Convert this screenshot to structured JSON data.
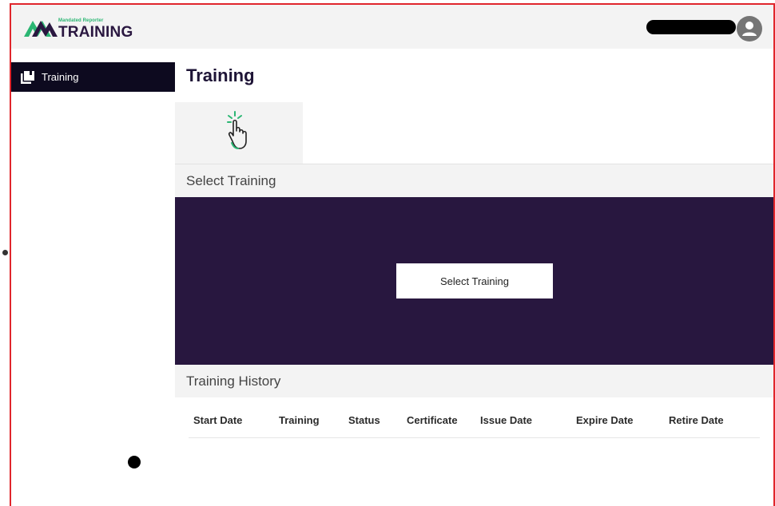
{
  "brand": {
    "small_text": "Mandated Reporter",
    "big_text": "TRAINING",
    "colors": {
      "green": "#2bb673",
      "navy": "#2a1740"
    }
  },
  "header": {
    "username": "",
    "avatar_icon": "user-avatar-icon"
  },
  "sidebar": {
    "items": [
      {
        "label": "Training",
        "icon": "book-stack-icon",
        "active": true
      }
    ]
  },
  "main": {
    "title": "Training",
    "tile_icon": "tap-hand-icon",
    "select_section": {
      "label": "Select Training",
      "button_label": "Select Training"
    },
    "history_section": {
      "label": "Training History",
      "columns": [
        "Start Date",
        "Training",
        "Status",
        "Certificate",
        "Issue Date",
        "Expire Date",
        "Retire Date"
      ],
      "rows": []
    }
  },
  "colors": {
    "hero_bg": "#28173f",
    "sidebar_active_bg": "#0d0a1f",
    "section_bg": "#f3f3f3",
    "frame_border": "#e0262c"
  }
}
